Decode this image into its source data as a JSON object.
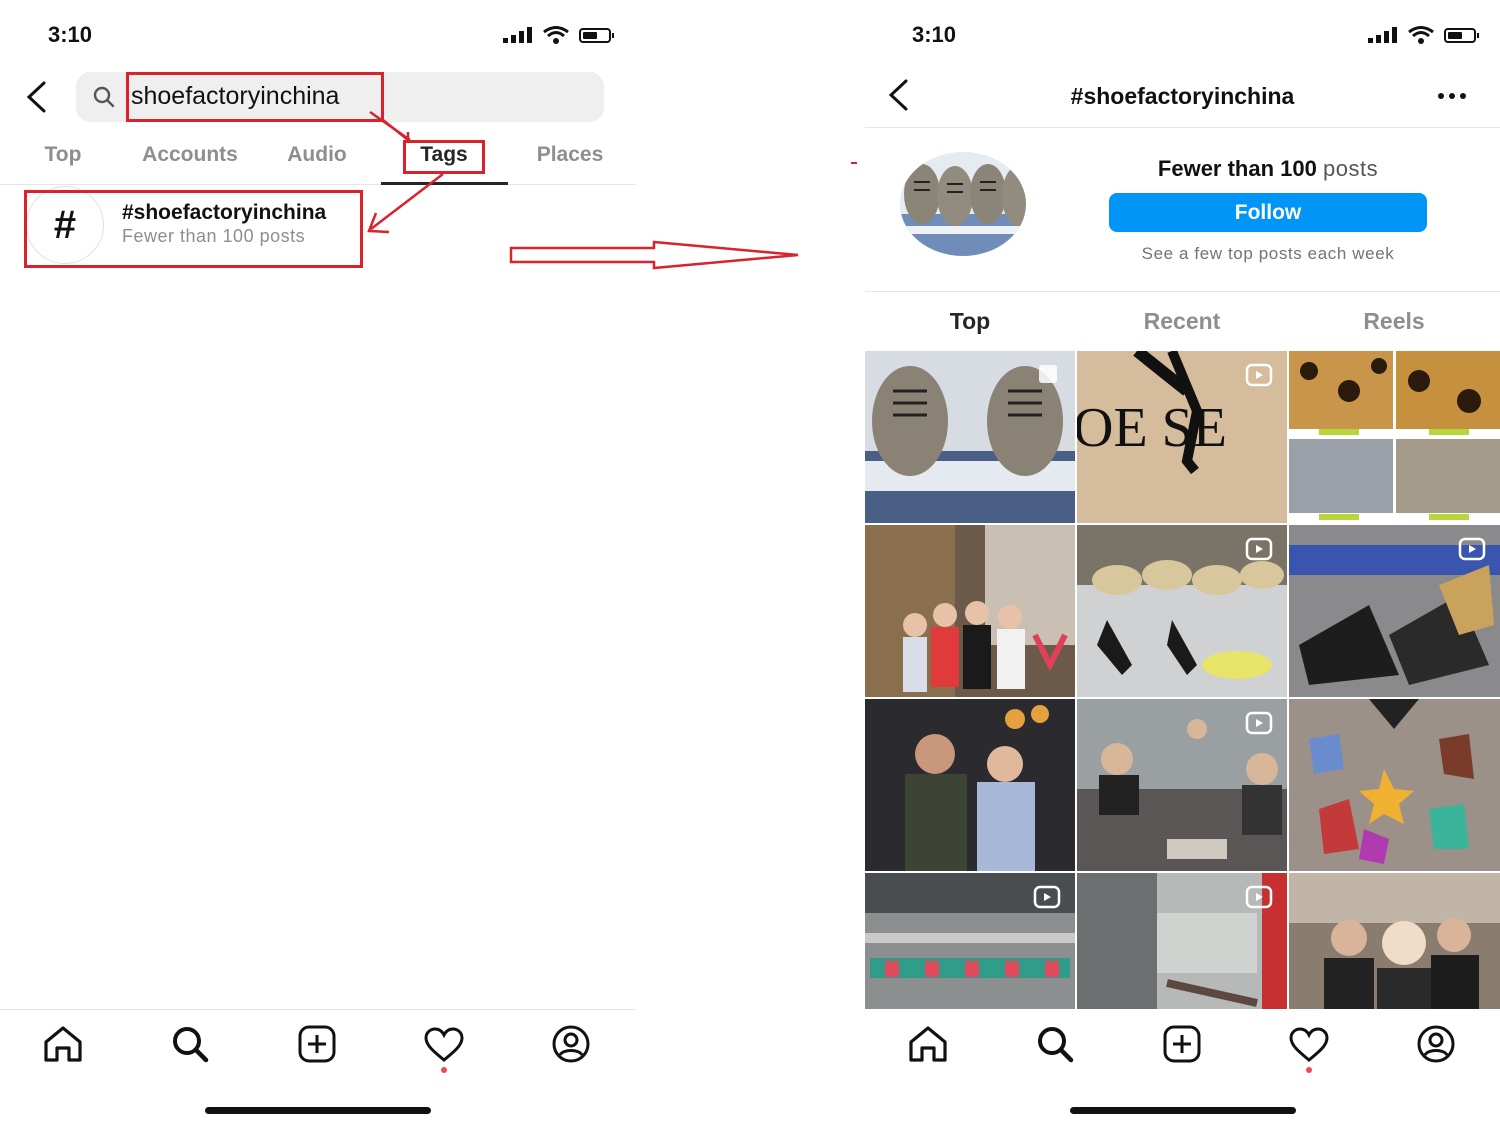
{
  "left_screen": {
    "status_time": "3:10",
    "search": {
      "query": "shoefactoryinchina"
    },
    "tabs": [
      "Top",
      "Accounts",
      "Audio",
      "Tags",
      "Places"
    ],
    "active_tab": "Tags",
    "result": {
      "tag": "#shoefactoryinchina",
      "count": "Fewer than 100 posts",
      "icon": "#"
    }
  },
  "right_screen": {
    "status_time": "3:10",
    "header_title": "#shoefactoryinchina",
    "posts_count_bold": "Fewer than 100",
    "posts_count_suffix": "posts",
    "follow_label": "Follow",
    "subtext": "See a few top posts each week",
    "tabs": [
      "Top",
      "Recent",
      "Reels"
    ],
    "active_tab": "Top"
  },
  "colors": {
    "accent": "#0095f6",
    "highlight_red": "#d9222b",
    "notification_dot": "#ed4956"
  },
  "icons": [
    "home-icon",
    "search-icon",
    "new-post-icon",
    "heart-icon",
    "profile-icon",
    "back-icon",
    "more-icon"
  ]
}
